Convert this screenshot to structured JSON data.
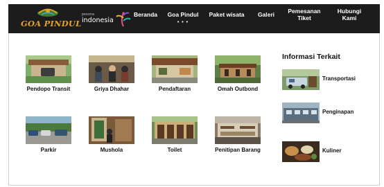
{
  "brand": {
    "logo_text": "GOA PINDUL",
    "partner_small": "pesona",
    "partner_big": "indonesia"
  },
  "nav": {
    "items": [
      {
        "label": "Beranda"
      },
      {
        "label": "Goa Pindul",
        "dots": "• • •"
      },
      {
        "label": "Paket wisata"
      },
      {
        "label": "Galeri"
      },
      {
        "label": "Pemesanan Tiket"
      },
      {
        "label": "Hubungi Kami"
      }
    ]
  },
  "facilities": [
    {
      "label": "Pendopo Transit",
      "icon": "pendopo-photo"
    },
    {
      "label": "Griya Dhahar",
      "icon": "restaurant-photo"
    },
    {
      "label": "Pendaftaran",
      "icon": "registration-photo"
    },
    {
      "label": "Omah Outbond",
      "icon": "outbound-photo"
    },
    {
      "label": "Parkir",
      "icon": "parking-photo"
    },
    {
      "label": "Mushola",
      "icon": "prayer-room-photo"
    },
    {
      "label": "Toilet",
      "icon": "toilet-photo"
    },
    {
      "label": "Penitipan Barang",
      "icon": "storage-photo"
    }
  ],
  "sidebar": {
    "title": "Informasi Terkait",
    "items": [
      {
        "label": "Transportasi",
        "icon": "transport-photo"
      },
      {
        "label": "Penginapan",
        "icon": "lodging-photo"
      },
      {
        "label": "Kuliner",
        "icon": "food-photo"
      }
    ]
  },
  "colors": {
    "navbar_bg": "#1c1c1c",
    "brand_orange": "#e3a22b",
    "text": "#111111"
  }
}
